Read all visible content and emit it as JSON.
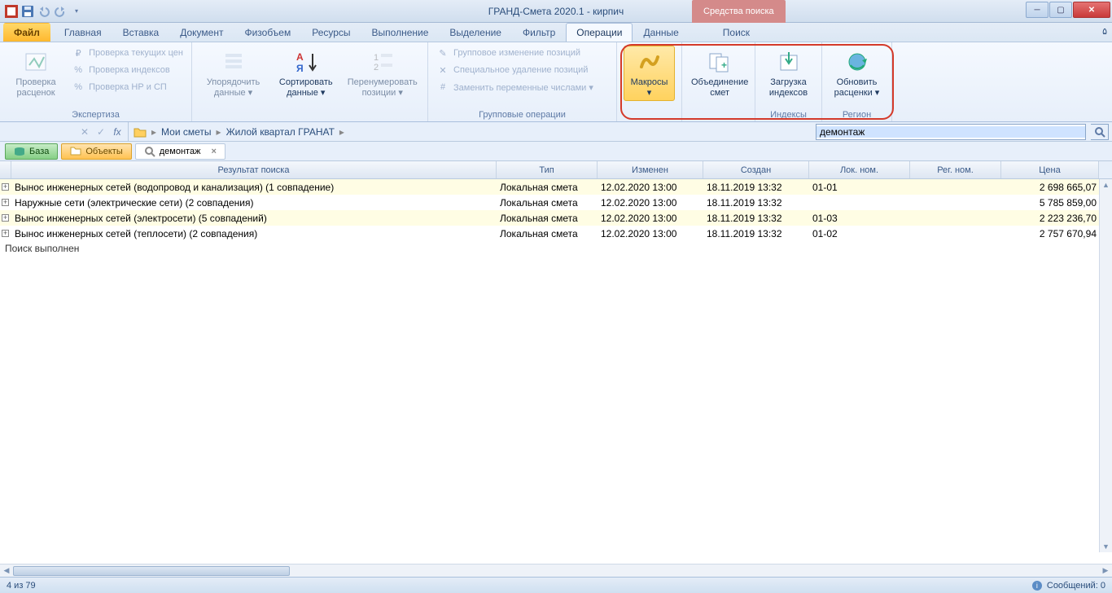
{
  "title": "ГРАНД-Смета 2020.1 -  кирпич",
  "tool_tab": "Средства поиска",
  "tabs": {
    "file": "Файл",
    "items": [
      "Главная",
      "Вставка",
      "Документ",
      "Физобъем",
      "Ресурсы",
      "Выполнение",
      "Выделение",
      "Фильтр",
      "Операции",
      "Данные"
    ],
    "search": "Поиск",
    "active": "Операции"
  },
  "ribbon": {
    "g1": {
      "big": "Проверка\nрасценок",
      "rows": [
        "Проверка текущих цен",
        "Проверка индексов",
        "Проверка НР и СП"
      ],
      "label": "Экспертиза"
    },
    "g2": {
      "b1": "Упорядочить\nданные ▾",
      "b2": "Сортировать\nданные ▾",
      "b3": "Перенумеровать\nпозиции ▾"
    },
    "g3": {
      "rows": [
        "Групповое изменение позиций",
        "Специальное удаление позиций",
        "Заменить переменные числами ▾"
      ],
      "label": "Групповые операции"
    },
    "g4": {
      "b": "Макросы\n▾"
    },
    "g5": {
      "b": "Объединение\nсмет"
    },
    "g6": {
      "b": "Загрузка\nиндексов",
      "label": "Индексы"
    },
    "g7": {
      "b": "Обновить\nрасценки ▾",
      "label": "Регион"
    }
  },
  "breadcrumb": {
    "root": "Мои сметы",
    "folder": "Жилой квартал ГРАНАТ"
  },
  "search_value": "демонтаж",
  "lowtabs": {
    "base": "База",
    "obj": "Объекты",
    "search": "демонтаж"
  },
  "grid": {
    "headers": {
      "res": "Результат поиска",
      "type": "Тип",
      "mod": "Изменен",
      "cre": "Создан",
      "lok": "Лок. ном.",
      "reg": "Рег. ном.",
      "price": "Цена"
    },
    "rows": [
      {
        "res": "Вынос инженерных сетей (водопровод и канализация) (1 совпадение)",
        "type": "Локальная смета",
        "mod": "12.02.2020 13:00",
        "cre": "18.11.2019 13:32",
        "lok": "01-01",
        "reg": "",
        "price": "2 698 665,07",
        "y": true
      },
      {
        "res": "Наружные сети (электрические сети) (2 совпадения)",
        "type": "Локальная смета",
        "mod": "12.02.2020 13:00",
        "cre": "18.11.2019 13:32",
        "lok": "",
        "reg": "",
        "price": "5 785 859,00",
        "y": false
      },
      {
        "res": "Вынос инженерных сетей (электросети) (5 совпадений)",
        "type": "Локальная смета",
        "mod": "12.02.2020 13:00",
        "cre": "18.11.2019 13:32",
        "lok": "01-03",
        "reg": "",
        "price": "2 223 236,70",
        "y": true
      },
      {
        "res": "Вынос инженерных сетей (теплосети) (2 совпадения)",
        "type": "Локальная смета",
        "mod": "12.02.2020 13:00",
        "cre": "18.11.2019 13:32",
        "lok": "01-02",
        "reg": "",
        "price": "2 757 670,94",
        "y": false
      }
    ],
    "status": "Поиск выполнен"
  },
  "statusbar": {
    "left": "4 из 79",
    "right": "Сообщений: 0"
  }
}
